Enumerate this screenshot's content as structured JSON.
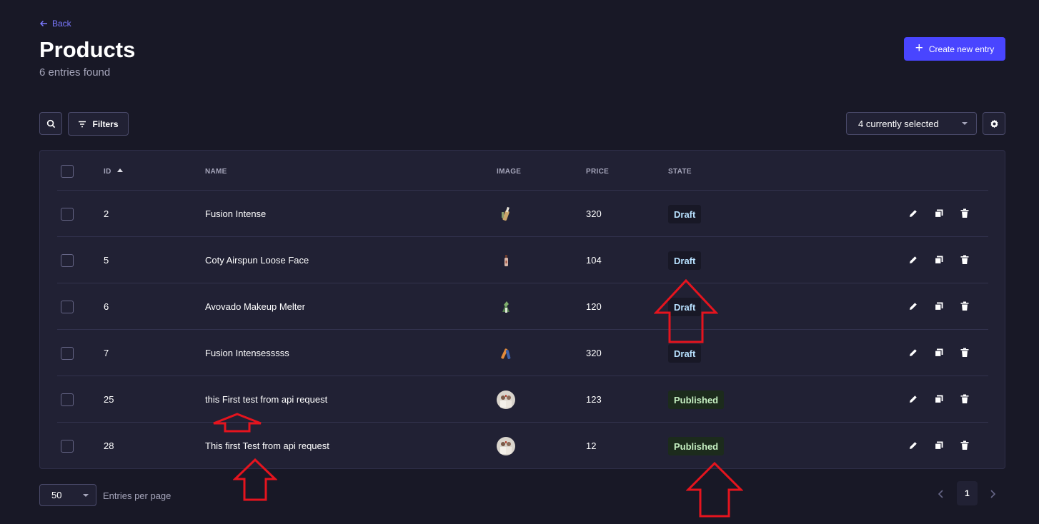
{
  "header": {
    "back_label": "Back",
    "title": "Products",
    "subtitle": "6 entries found",
    "create_label": "Create new entry"
  },
  "toolbar": {
    "filters_label": "Filters",
    "columns_selected": "4 currently selected"
  },
  "table": {
    "columns": [
      "ID",
      "NAME",
      "IMAGE",
      "PRICE",
      "STATE"
    ],
    "sorted_column": "ID",
    "rows": [
      {
        "id": "2",
        "name": "Fusion Intense",
        "price": "320",
        "state": "Draft",
        "image": "bottle-icon"
      },
      {
        "id": "5",
        "name": "Coty Airspun Loose Face",
        "price": "104",
        "state": "Draft",
        "image": "bottle-icon"
      },
      {
        "id": "6",
        "name": "Avovado Makeup Melter",
        "price": "120",
        "state": "Draft",
        "image": "plant-icon"
      },
      {
        "id": "7",
        "name": "Fusion Intensesssss",
        "price": "320",
        "state": "Draft",
        "image": "tube-icon"
      },
      {
        "id": "25",
        "name": "this First test from api request",
        "price": "123",
        "state": "Published",
        "image": "avatar-photo"
      },
      {
        "id": "28",
        "name": "This first Test from api request",
        "price": "12",
        "state": "Published",
        "image": "avatar-photo"
      }
    ]
  },
  "footer": {
    "per_page_value": "50",
    "per_page_label": "Entries per page",
    "current_page": "1"
  },
  "colors": {
    "background": "#181826",
    "panel": "#212134",
    "accent": "#4945ff",
    "draft_text": "#b8e1ff",
    "published_text": "#c6f0c2",
    "annotation_arrow": "#e5141e"
  }
}
